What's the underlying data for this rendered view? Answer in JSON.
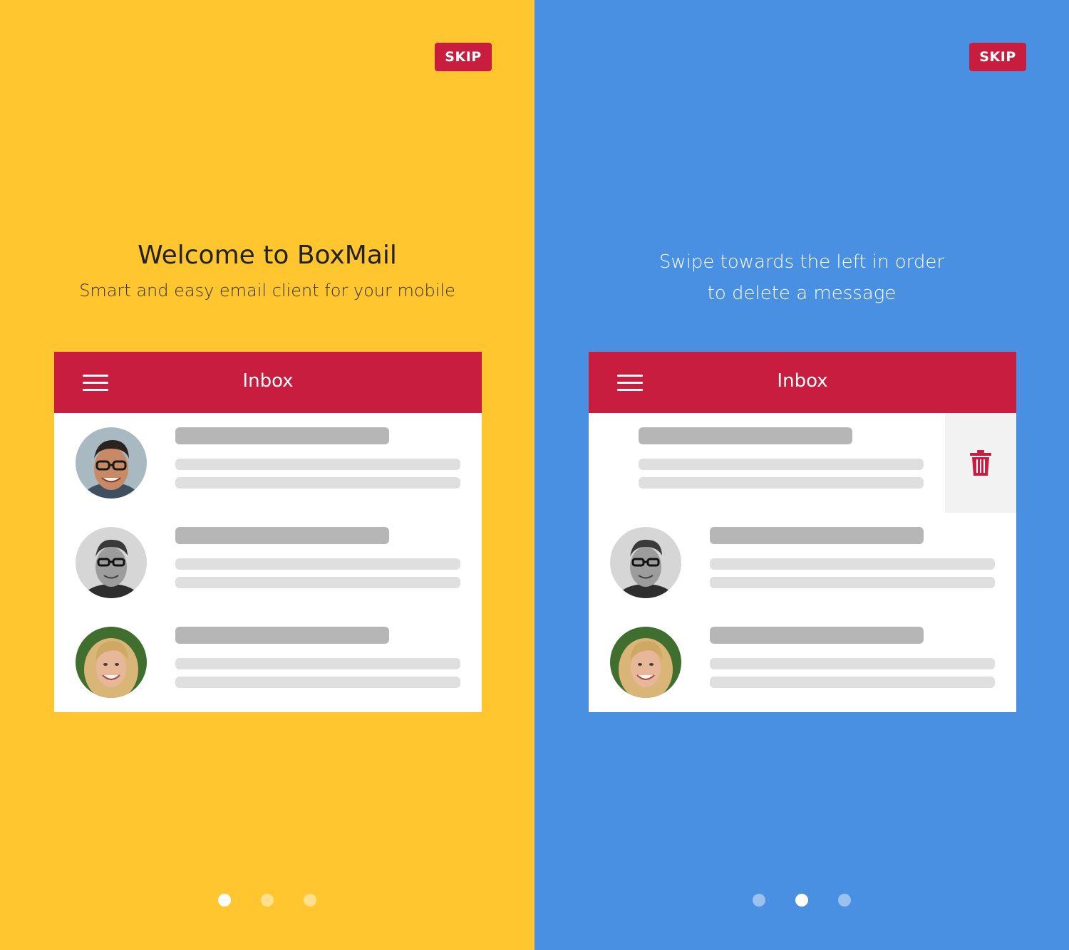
{
  "screens": [
    {
      "background": "#FFC630",
      "skip_label": "SKIP",
      "title": "Welcome to BoxMail",
      "subtitle": "Smart and easy email client for your mobile",
      "inbox_title": "Inbox",
      "active_dot": 1
    },
    {
      "background": "#4A90E2",
      "skip_label": "SKIP",
      "instruction_line1": "Swipe towards the left in order",
      "instruction_line2": "to delete a message",
      "inbox_title": "Inbox",
      "active_dot": 2
    }
  ],
  "colors": {
    "accent_red": "#C81D3E",
    "skeleton_dark": "#B6B6B6",
    "skeleton_light": "#DFDFDF",
    "delete_zone": "#F2F2F2"
  },
  "icons": {
    "menu": "hamburger-menu-icon",
    "delete": "trash-icon"
  },
  "page_count": 3
}
